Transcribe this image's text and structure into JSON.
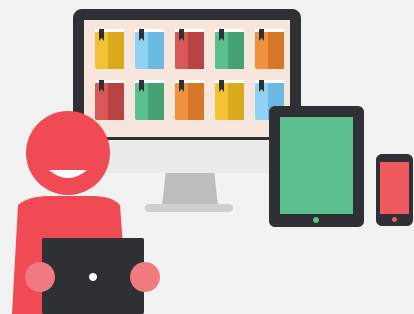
{
  "scene": {
    "background": "#f2f2f2",
    "monitor": {
      "bezel_color": "#2f3033",
      "screen_color": "#f6e6dc",
      "chin_color": "#ebebeb",
      "stand_color": "#bdbdbd",
      "books": [
        {
          "color": "#f1c232",
          "shade": "#d9a91e",
          "icon": "book-icon"
        },
        {
          "color": "#8fd3f4",
          "shade": "#6ab9e0",
          "icon": "book-icon"
        },
        {
          "color": "#d85858",
          "shade": "#b94343",
          "icon": "book-icon"
        },
        {
          "color": "#5cbf8f",
          "shade": "#46a275",
          "icon": "book-icon"
        },
        {
          "color": "#f0913c",
          "shade": "#d6772a",
          "icon": "book-icon"
        },
        {
          "color": "#d85858",
          "shade": "#b94343",
          "icon": "book-icon"
        },
        {
          "color": "#5cbf8f",
          "shade": "#46a275",
          "icon": "book-icon"
        },
        {
          "color": "#f0913c",
          "shade": "#d6772a",
          "icon": "book-icon"
        },
        {
          "color": "#f1c232",
          "shade": "#d9a91e",
          "icon": "book-icon"
        },
        {
          "color": "#8fd3f4",
          "shade": "#6ab9e0",
          "icon": "book-icon"
        }
      ],
      "bookmark_color": "#2f3033"
    },
    "tablet": {
      "bezel_color": "#2f3033",
      "screen_color": "#5cbf8f",
      "button_color": "#5cbf8f"
    },
    "phone": {
      "bezel_color": "#2f3033",
      "screen_color": "#f05a5f",
      "button_color": "#f05a5f"
    },
    "person": {
      "color": "#f04a55",
      "hand_color": "#f07a7f",
      "smile_color": "#ffffff"
    },
    "laptop": {
      "color": "#2f3033",
      "dot_color": "#ffffff"
    }
  }
}
